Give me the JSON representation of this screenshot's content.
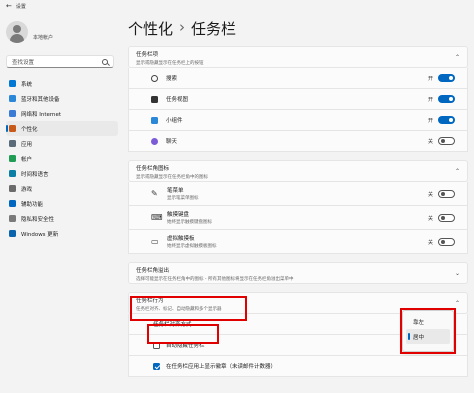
{
  "window": {
    "title": "设置"
  },
  "profile": {
    "name": "本地帐户"
  },
  "search": {
    "placeholder": "查找设置"
  },
  "nav": [
    {
      "label": "系统",
      "color": "#0078d4",
      "active": false
    },
    {
      "label": "蓝牙和其他设备",
      "color": "#2b88d8",
      "active": false
    },
    {
      "label": "网络和 Internet",
      "color": "#3a7bd5",
      "active": false
    },
    {
      "label": "个性化",
      "color": "#c85a19",
      "active": true
    },
    {
      "label": "应用",
      "color": "#5c6b7a",
      "active": false
    },
    {
      "label": "帐户",
      "color": "#1f9d55",
      "active": false
    },
    {
      "label": "时间和语言",
      "color": "#0a7ea4",
      "active": false
    },
    {
      "label": "游戏",
      "color": "#6b6b6b",
      "active": false
    },
    {
      "label": "辅助功能",
      "color": "#0067c0",
      "active": false
    },
    {
      "label": "隐私和安全性",
      "color": "#7a7a7a",
      "active": false
    },
    {
      "label": "Windows 更新",
      "color": "#0a64ad",
      "active": false
    }
  ],
  "breadcrumb": {
    "parent": "个性化",
    "separator": "›",
    "current": "任务栏"
  },
  "taskbar_items": {
    "title": "任务栏项",
    "subtitle": "显示或隐藏显示在任务栏上的按钮",
    "rows": [
      {
        "label": "搜索",
        "state": "开",
        "on": true
      },
      {
        "label": "任务视图",
        "state": "开",
        "on": true
      },
      {
        "label": "小组件",
        "state": "开",
        "on": true
      },
      {
        "label": "聊天",
        "state": "关",
        "on": false
      }
    ]
  },
  "corner_icons": {
    "title": "任务栏角图标",
    "subtitle": "显示或隐藏显示在任务栏角中的图标",
    "rows": [
      {
        "label": "笔菜单",
        "sub": "显示笔菜单图标",
        "state": "关",
        "on": false
      },
      {
        "label": "触摸键盘",
        "sub": "始终显示触摸键盘图标",
        "state": "关",
        "on": false
      },
      {
        "label": "虚拟触摸板",
        "sub": "始终显示虚拟触摸板图标",
        "state": "关",
        "on": false
      }
    ]
  },
  "overflow": {
    "title": "任务栏角溢出",
    "subtitle": "选择可能显示在任务栏角中的图标 - 所有其他图标将显示在任务栏角溢出菜单中"
  },
  "behaviors": {
    "title": "任务栏行为",
    "subtitle": "任务栏对齐、标记、自动隐藏和多个显示器",
    "rows": [
      {
        "label": "任务栏对齐方式",
        "type": "dropdown"
      },
      {
        "label": "自动隐藏任务栏",
        "type": "checkbox",
        "checked": false
      },
      {
        "label": "在任务栏应用上显示徽章（未读邮件计数器）",
        "type": "checkbox",
        "checked": true
      }
    ],
    "alignment_options": [
      "靠左",
      "居中"
    ],
    "alignment_selected": "居中"
  },
  "highlight_color": "#e10000",
  "accent_color": "#0067c0"
}
